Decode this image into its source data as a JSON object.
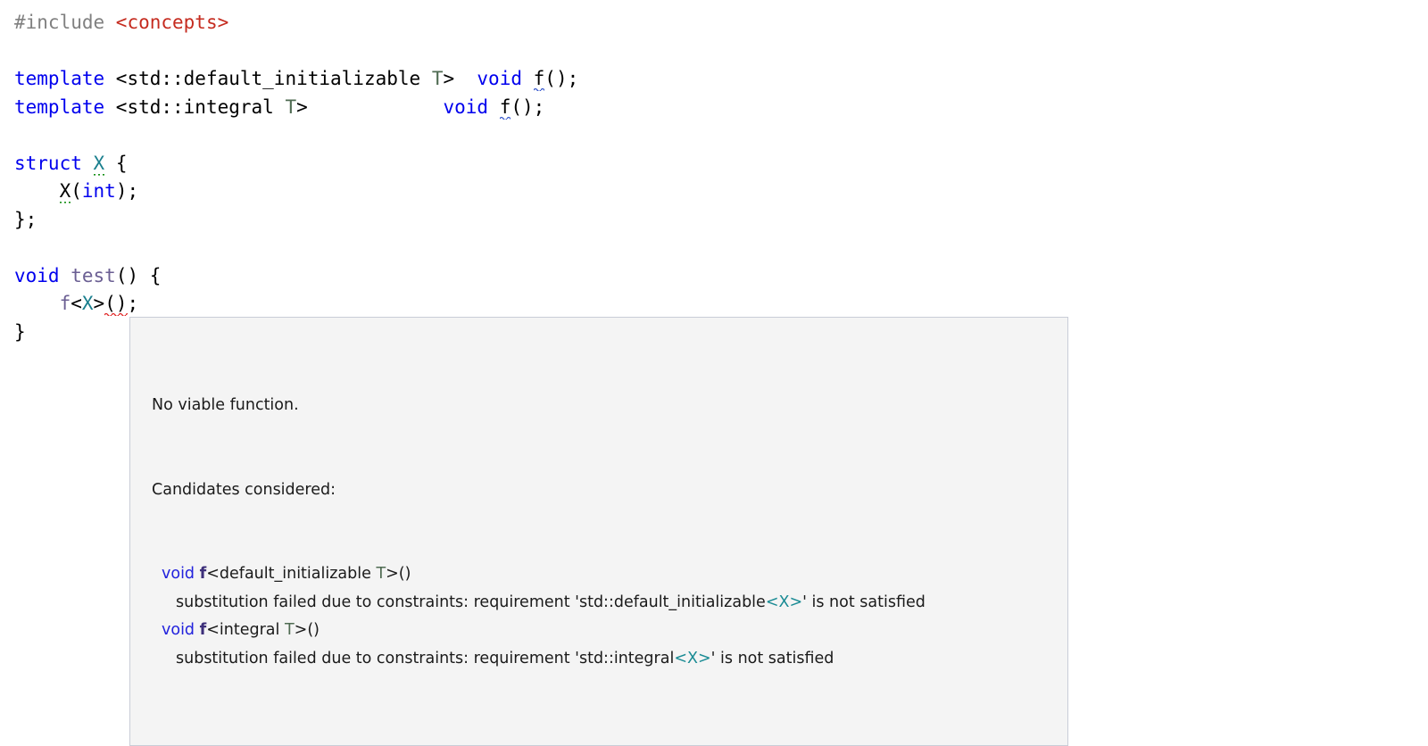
{
  "editor": {
    "language": "cpp",
    "background_color": "#ffffff",
    "colors": {
      "preprocessor": "#808080",
      "include_path": "#c52b1f",
      "keyword": "#0000ee",
      "template_param": "#4f6b52",
      "type": "#1a7f8e",
      "function": "#6b5f93",
      "plain": "#000000",
      "error_squiggle": "#e02020",
      "info_squiggle": "#3355cc",
      "hint_squiggle": "#169016"
    },
    "lines": [
      {
        "id": "line-include",
        "tokens": [
          {
            "text": "#include ",
            "kind": "preprocessor"
          },
          {
            "text": "<concepts>",
            "kind": "include_path"
          }
        ]
      },
      {
        "id": "line-blank-1",
        "tokens": [
          {
            "text": " ",
            "kind": "plain"
          }
        ]
      },
      {
        "id": "line-template-default-initializable",
        "tokens": [
          {
            "text": "template",
            "kind": "keyword"
          },
          {
            "text": " <std::default_initializable ",
            "kind": "plain"
          },
          {
            "text": "T",
            "kind": "template_param"
          },
          {
            "text": ">  ",
            "kind": "plain"
          },
          {
            "text": "void",
            "kind": "keyword"
          },
          {
            "text": " ",
            "kind": "plain"
          },
          {
            "text": "f",
            "kind": "plain",
            "underline": "info"
          },
          {
            "text": "();",
            "kind": "plain"
          }
        ]
      },
      {
        "id": "line-template-integral",
        "tokens": [
          {
            "text": "template",
            "kind": "keyword"
          },
          {
            "text": " <std::integral ",
            "kind": "plain"
          },
          {
            "text": "T",
            "kind": "template_param"
          },
          {
            "text": ">            ",
            "kind": "plain"
          },
          {
            "text": "void",
            "kind": "keyword"
          },
          {
            "text": " ",
            "kind": "plain"
          },
          {
            "text": "f",
            "kind": "plain",
            "underline": "info"
          },
          {
            "text": "();",
            "kind": "plain"
          }
        ]
      },
      {
        "id": "line-blank-2",
        "tokens": [
          {
            "text": " ",
            "kind": "plain"
          }
        ]
      },
      {
        "id": "line-struct-x",
        "tokens": [
          {
            "text": "struct",
            "kind": "keyword"
          },
          {
            "text": " ",
            "kind": "plain"
          },
          {
            "text": "X",
            "kind": "type",
            "underline": "hint"
          },
          {
            "text": " {",
            "kind": "plain"
          }
        ]
      },
      {
        "id": "line-ctor",
        "tokens": [
          {
            "text": "    ",
            "kind": "plain"
          },
          {
            "text": "X",
            "kind": "plain",
            "underline": "hint"
          },
          {
            "text": "(",
            "kind": "plain"
          },
          {
            "text": "int",
            "kind": "keyword"
          },
          {
            "text": ");",
            "kind": "plain"
          }
        ]
      },
      {
        "id": "line-struct-close",
        "tokens": [
          {
            "text": "};",
            "kind": "plain"
          }
        ]
      },
      {
        "id": "line-blank-3",
        "tokens": [
          {
            "text": " ",
            "kind": "plain"
          }
        ]
      },
      {
        "id": "line-void-test",
        "tokens": [
          {
            "text": "void",
            "kind": "keyword"
          },
          {
            "text": " ",
            "kind": "plain"
          },
          {
            "text": "test",
            "kind": "function"
          },
          {
            "text": "() {",
            "kind": "plain"
          }
        ]
      },
      {
        "id": "line-call-f",
        "tokens": [
          {
            "text": "    ",
            "kind": "plain"
          },
          {
            "text": "f",
            "kind": "function"
          },
          {
            "text": "<",
            "kind": "plain"
          },
          {
            "text": "X",
            "kind": "type"
          },
          {
            "text": ">",
            "kind": "plain"
          },
          {
            "text": "()",
            "kind": "plain",
            "underline": "error"
          },
          {
            "text": ";",
            "kind": "plain"
          }
        ]
      },
      {
        "id": "line-fn-close",
        "tokens": [
          {
            "text": "}",
            "kind": "plain"
          }
        ]
      }
    ]
  },
  "tooltip": {
    "title": "No viable function.",
    "subtitle": "Candidates considered:",
    "background_color": "#f4f4f4",
    "border_color": "#c9cdd7",
    "candidates": [
      {
        "signature": [
          {
            "text": "void",
            "kind": "keyword"
          },
          {
            "text": " ",
            "kind": "plain"
          },
          {
            "text": "f",
            "kind": "function"
          },
          {
            "text": "<default_initializable ",
            "kind": "plain"
          },
          {
            "text": "T",
            "kind": "template_param"
          },
          {
            "text": ">()",
            "kind": "plain"
          }
        ],
        "reason": [
          {
            "text": "substitution failed due to constraints: requirement 'std::default_initializable",
            "kind": "plain"
          },
          {
            "text": "<X>",
            "kind": "type"
          },
          {
            "text": "' is not satisfied",
            "kind": "plain"
          }
        ]
      },
      {
        "signature": [
          {
            "text": "void",
            "kind": "keyword"
          },
          {
            "text": " ",
            "kind": "plain"
          },
          {
            "text": "f",
            "kind": "function"
          },
          {
            "text": "<integral ",
            "kind": "plain"
          },
          {
            "text": "T",
            "kind": "template_param"
          },
          {
            "text": ">()",
            "kind": "plain"
          }
        ],
        "reason": [
          {
            "text": "substitution failed due to constraints: requirement 'std::integral",
            "kind": "plain"
          },
          {
            "text": "<X>",
            "kind": "type"
          },
          {
            "text": "' is not satisfied",
            "kind": "plain"
          }
        ]
      }
    ]
  }
}
